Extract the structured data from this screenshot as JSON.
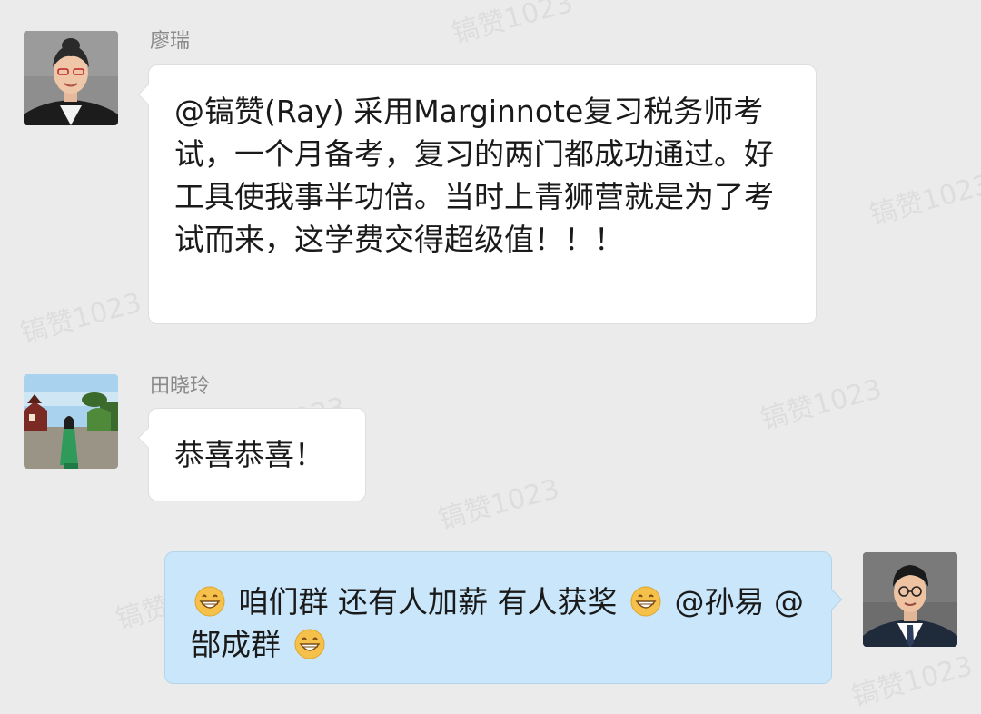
{
  "watermark_text": "镐赞1023",
  "messages": [
    {
      "sender": "廖瑞",
      "side": "left",
      "text": "@镐赞(Ray) 采用Marginnote复习税务师考试，一个月备考，复习的两门都成功通过。好工具使我事半功倍。当时上青狮营就是为了考试而来，这学费交得超级值！！！"
    },
    {
      "sender": "田晓玲",
      "side": "left",
      "text": "恭喜恭喜！"
    },
    {
      "side": "right",
      "parts": [
        "咱们群 还有人加薪 有人获奖",
        "@孙易 @郜成群"
      ],
      "emoji": "grinning-face-icon"
    }
  ],
  "colors": {
    "background": "#ebebeb",
    "left_bubble": "#ffffff",
    "right_bubble": "#c9e6fa",
    "name_text": "#8a8a8a"
  }
}
